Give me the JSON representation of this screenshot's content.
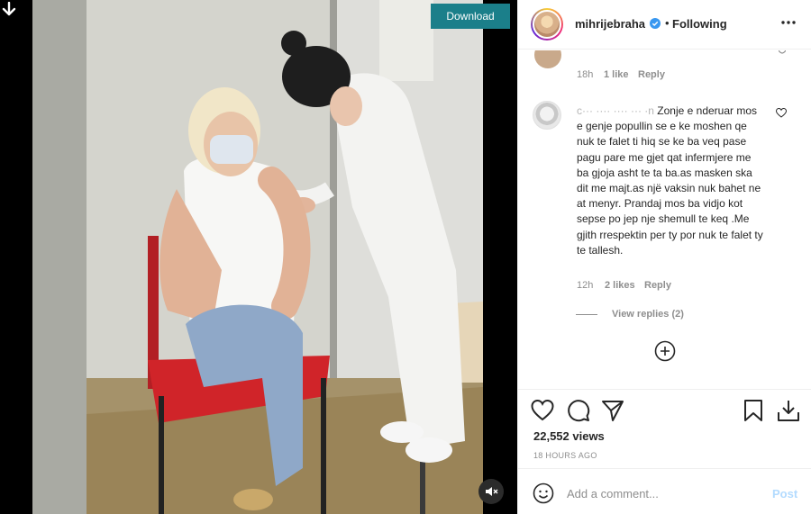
{
  "header": {
    "username": "mihrijebraha",
    "separator": "•",
    "follow_status": "Following"
  },
  "video": {
    "download_label": "Download"
  },
  "previous_comment": {
    "time": "18h",
    "likes": "1 like",
    "reply_label": "Reply"
  },
  "comment": {
    "username": "c··· ···· ···· ··· ·n",
    "text": "Zonje e nderuar mos e genje popullin se e ke moshen qe nuk te falet ti hiq se ke ba veq pase pagu pare me gjet qat infermjere me ba gjoja asht te ta ba.as masken ska dit me majt.as një vaksin nuk bahet ne at menyr. Prandaj mos ba vidjo kot sepse po jep nje shemull te keq .Me gjith rrespektin per ty por nuk te falet ty te tallesh.",
    "time": "12h",
    "likes": "2 likes",
    "reply_label": "Reply",
    "view_replies": "View replies (2)"
  },
  "post": {
    "views": "22,552 views",
    "timestamp": "18 HOURS AGO"
  },
  "add_comment": {
    "placeholder": "Add a comment...",
    "post_label": "Post"
  },
  "colors": {
    "download_bg": "#1b7f8a",
    "verified": "#3897f0",
    "post_disabled": "#b3dbff"
  }
}
